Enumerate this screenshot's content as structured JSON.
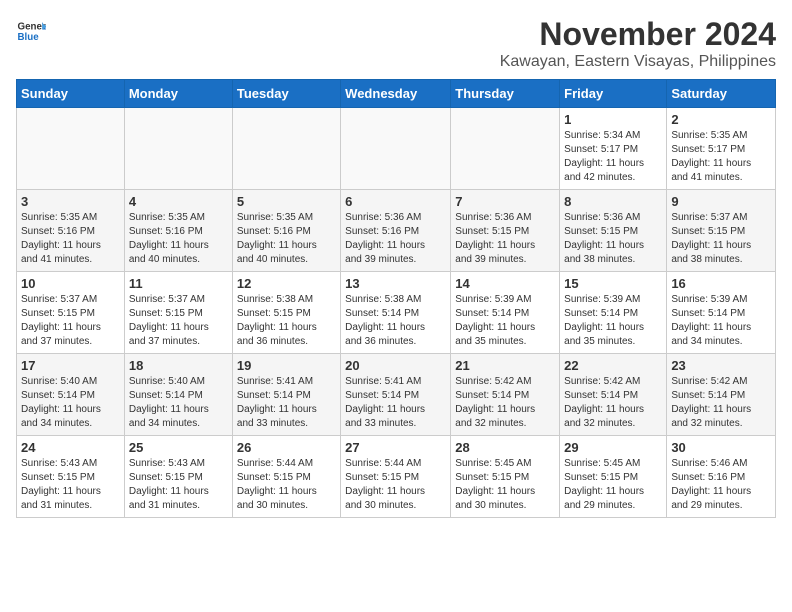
{
  "header": {
    "logo_line1": "General",
    "logo_line2": "Blue",
    "month_title": "November 2024",
    "location": "Kawayan, Eastern Visayas, Philippines"
  },
  "days_of_week": [
    "Sunday",
    "Monday",
    "Tuesday",
    "Wednesday",
    "Thursday",
    "Friday",
    "Saturday"
  ],
  "weeks": [
    {
      "days": [
        {
          "num": "",
          "info": "",
          "empty": true
        },
        {
          "num": "",
          "info": "",
          "empty": true
        },
        {
          "num": "",
          "info": "",
          "empty": true
        },
        {
          "num": "",
          "info": "",
          "empty": true
        },
        {
          "num": "",
          "info": "",
          "empty": true
        },
        {
          "num": "1",
          "info": "Sunrise: 5:34 AM\nSunset: 5:17 PM\nDaylight: 11 hours\nand 42 minutes.",
          "empty": false
        },
        {
          "num": "2",
          "info": "Sunrise: 5:35 AM\nSunset: 5:17 PM\nDaylight: 11 hours\nand 41 minutes.",
          "empty": false
        }
      ]
    },
    {
      "days": [
        {
          "num": "3",
          "info": "Sunrise: 5:35 AM\nSunset: 5:16 PM\nDaylight: 11 hours\nand 41 minutes.",
          "empty": false
        },
        {
          "num": "4",
          "info": "Sunrise: 5:35 AM\nSunset: 5:16 PM\nDaylight: 11 hours\nand 40 minutes.",
          "empty": false
        },
        {
          "num": "5",
          "info": "Sunrise: 5:35 AM\nSunset: 5:16 PM\nDaylight: 11 hours\nand 40 minutes.",
          "empty": false
        },
        {
          "num": "6",
          "info": "Sunrise: 5:36 AM\nSunset: 5:16 PM\nDaylight: 11 hours\nand 39 minutes.",
          "empty": false
        },
        {
          "num": "7",
          "info": "Sunrise: 5:36 AM\nSunset: 5:15 PM\nDaylight: 11 hours\nand 39 minutes.",
          "empty": false
        },
        {
          "num": "8",
          "info": "Sunrise: 5:36 AM\nSunset: 5:15 PM\nDaylight: 11 hours\nand 38 minutes.",
          "empty": false
        },
        {
          "num": "9",
          "info": "Sunrise: 5:37 AM\nSunset: 5:15 PM\nDaylight: 11 hours\nand 38 minutes.",
          "empty": false
        }
      ]
    },
    {
      "days": [
        {
          "num": "10",
          "info": "Sunrise: 5:37 AM\nSunset: 5:15 PM\nDaylight: 11 hours\nand 37 minutes.",
          "empty": false
        },
        {
          "num": "11",
          "info": "Sunrise: 5:37 AM\nSunset: 5:15 PM\nDaylight: 11 hours\nand 37 minutes.",
          "empty": false
        },
        {
          "num": "12",
          "info": "Sunrise: 5:38 AM\nSunset: 5:15 PM\nDaylight: 11 hours\nand 36 minutes.",
          "empty": false
        },
        {
          "num": "13",
          "info": "Sunrise: 5:38 AM\nSunset: 5:14 PM\nDaylight: 11 hours\nand 36 minutes.",
          "empty": false
        },
        {
          "num": "14",
          "info": "Sunrise: 5:39 AM\nSunset: 5:14 PM\nDaylight: 11 hours\nand 35 minutes.",
          "empty": false
        },
        {
          "num": "15",
          "info": "Sunrise: 5:39 AM\nSunset: 5:14 PM\nDaylight: 11 hours\nand 35 minutes.",
          "empty": false
        },
        {
          "num": "16",
          "info": "Sunrise: 5:39 AM\nSunset: 5:14 PM\nDaylight: 11 hours\nand 34 minutes.",
          "empty": false
        }
      ]
    },
    {
      "days": [
        {
          "num": "17",
          "info": "Sunrise: 5:40 AM\nSunset: 5:14 PM\nDaylight: 11 hours\nand 34 minutes.",
          "empty": false
        },
        {
          "num": "18",
          "info": "Sunrise: 5:40 AM\nSunset: 5:14 PM\nDaylight: 11 hours\nand 34 minutes.",
          "empty": false
        },
        {
          "num": "19",
          "info": "Sunrise: 5:41 AM\nSunset: 5:14 PM\nDaylight: 11 hours\nand 33 minutes.",
          "empty": false
        },
        {
          "num": "20",
          "info": "Sunrise: 5:41 AM\nSunset: 5:14 PM\nDaylight: 11 hours\nand 33 minutes.",
          "empty": false
        },
        {
          "num": "21",
          "info": "Sunrise: 5:42 AM\nSunset: 5:14 PM\nDaylight: 11 hours\nand 32 minutes.",
          "empty": false
        },
        {
          "num": "22",
          "info": "Sunrise: 5:42 AM\nSunset: 5:14 PM\nDaylight: 11 hours\nand 32 minutes.",
          "empty": false
        },
        {
          "num": "23",
          "info": "Sunrise: 5:42 AM\nSunset: 5:14 PM\nDaylight: 11 hours\nand 32 minutes.",
          "empty": false
        }
      ]
    },
    {
      "days": [
        {
          "num": "24",
          "info": "Sunrise: 5:43 AM\nSunset: 5:15 PM\nDaylight: 11 hours\nand 31 minutes.",
          "empty": false
        },
        {
          "num": "25",
          "info": "Sunrise: 5:43 AM\nSunset: 5:15 PM\nDaylight: 11 hours\nand 31 minutes.",
          "empty": false
        },
        {
          "num": "26",
          "info": "Sunrise: 5:44 AM\nSunset: 5:15 PM\nDaylight: 11 hours\nand 30 minutes.",
          "empty": false
        },
        {
          "num": "27",
          "info": "Sunrise: 5:44 AM\nSunset: 5:15 PM\nDaylight: 11 hours\nand 30 minutes.",
          "empty": false
        },
        {
          "num": "28",
          "info": "Sunrise: 5:45 AM\nSunset: 5:15 PM\nDaylight: 11 hours\nand 30 minutes.",
          "empty": false
        },
        {
          "num": "29",
          "info": "Sunrise: 5:45 AM\nSunset: 5:15 PM\nDaylight: 11 hours\nand 29 minutes.",
          "empty": false
        },
        {
          "num": "30",
          "info": "Sunrise: 5:46 AM\nSunset: 5:16 PM\nDaylight: 11 hours\nand 29 minutes.",
          "empty": false
        }
      ]
    }
  ]
}
